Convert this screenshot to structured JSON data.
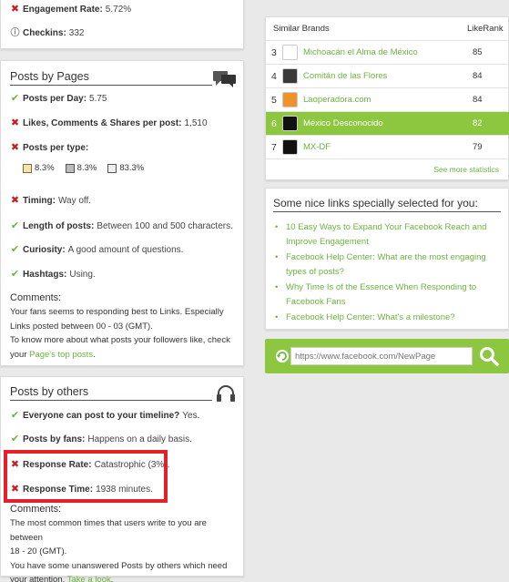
{
  "top_card": {
    "engagement_label": "Engagement Rate:",
    "engagement_value": "5.72%",
    "checkins_label": "Checkins:",
    "checkins_value": "332"
  },
  "posts_by_pages": {
    "title": "Posts by Pages",
    "items": [
      {
        "status": "ok",
        "label": "Posts per Day:",
        "value": "5.75"
      },
      {
        "status": "bad",
        "label": "Likes, Comments & Shares per post:",
        "value": "1,510"
      },
      {
        "status": "bad",
        "label": "Posts per type:",
        "value": ""
      },
      {
        "status": "bad",
        "label": "Timing:",
        "value": "Way off."
      },
      {
        "status": "ok",
        "label": "Length of posts:",
        "value": "Between 100 and 500 characters."
      },
      {
        "status": "ok",
        "label": "Curiosity:",
        "value": "A good amount of questions."
      },
      {
        "status": "ok",
        "label": "Hashtags:",
        "value": "Using."
      }
    ],
    "types": [
      {
        "icon": "photo-icon",
        "value": "8.3%"
      },
      {
        "icon": "video-icon",
        "value": "8.3%"
      },
      {
        "icon": "link-icon",
        "value": "83.3%"
      }
    ],
    "comments_label": "Comments:",
    "comment_line1": "Your fans seems to responding best to Links. Especially",
    "comment_line2": "Links posted between 00 - 03 (GMT).",
    "comment_line3": "To know more about what posts your followers like, check",
    "comment_line4_prefix": "your ",
    "comment_link": "Page's top posts",
    "comment_line4_suffix": "."
  },
  "posts_by_others": {
    "title": "Posts by others",
    "items": [
      {
        "status": "ok",
        "label": "Everyone can post to your timeline?",
        "value": "Yes."
      },
      {
        "status": "ok",
        "label": "Posts by fans:",
        "value": "Happens on a daily basis."
      },
      {
        "status": "bad",
        "label": "Response Rate:",
        "value": "Catastrophic (3%)."
      },
      {
        "status": "bad",
        "label": "Response Time:",
        "value": "1938 minutes."
      }
    ],
    "comments_label": "Comments:",
    "comment_line1": "The most common times that users write to you are between",
    "comment_line2": "18 - 20 (GMT).",
    "comment_line3": "You have some unanswered Posts by others which need",
    "comment_line4_prefix": "your attention. ",
    "comment_link": "Take a look",
    "comment_line4_suffix": "."
  },
  "similar_brands": {
    "header_brand": "Similar Brands",
    "header_rank": "LikeRank",
    "rows": [
      {
        "num": "3",
        "name": "Michoacán el Alma de México",
        "rank": "85",
        "logo_color": "#ffffff",
        "highlight": false
      },
      {
        "num": "4",
        "name": "Comitán de las Flores",
        "rank": "84",
        "logo_color": "#3a3a3a",
        "highlight": false
      },
      {
        "num": "5",
        "name": "Laoperadora.com",
        "rank": "84",
        "logo_color": "#f0922b",
        "highlight": false
      },
      {
        "num": "6",
        "name": "México Desconocido",
        "rank": "82",
        "logo_color": "#111111",
        "highlight": true
      },
      {
        "num": "7",
        "name": "MX-DF",
        "rank": "79",
        "logo_color": "#111111",
        "highlight": false
      }
    ],
    "see_more": "See more statistics"
  },
  "nice_links": {
    "title": "Some nice links specially selected for you:",
    "links": [
      "10 Easy Ways to Expand Your Facebook Reach and Improve Engagement",
      "Facebook Help Center: What are the most engaging types of posts?",
      "Why Time Is of the Essence When Responding to Facebook Fans",
      "Facebook Help Center: What's a milestone?"
    ]
  },
  "search": {
    "placeholder": "https://www.facebook.com/NewPage"
  },
  "colors": {
    "accent_green": "#8dc63f",
    "link_green": "#6cb33f",
    "bad_red": "#c81d25",
    "highlight_box": "#e4212b"
  }
}
